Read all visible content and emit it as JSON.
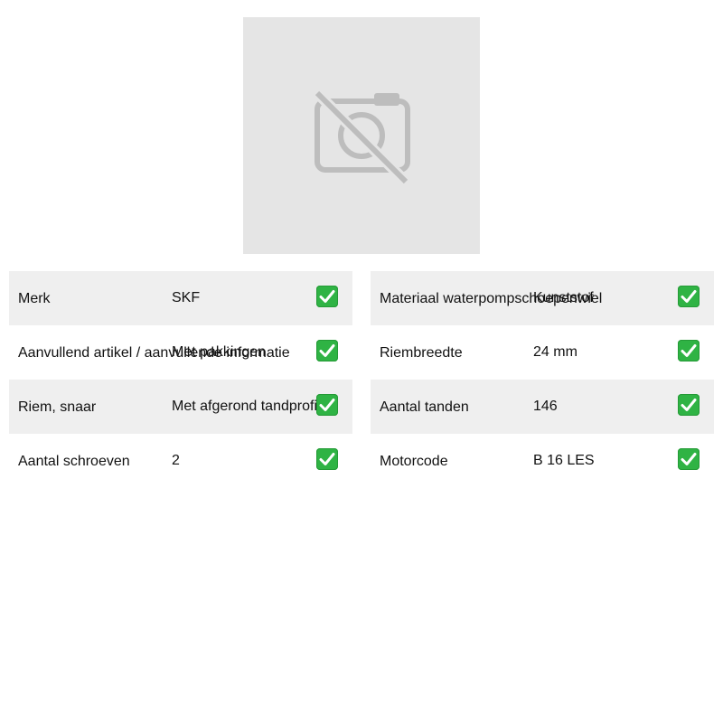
{
  "image": {
    "icon": "camera-off-icon"
  },
  "specs_left": [
    {
      "label": "Merk",
      "value": "SKF"
    },
    {
      "label": "Aanvullend artikel / aanvullende informatie",
      "value": "Met pakkingen"
    },
    {
      "label": "Riem, snaar",
      "value": "Met afgerond tandprofiel"
    },
    {
      "label": "Aantal schroeven",
      "value": "2"
    }
  ],
  "specs_right": [
    {
      "label": "Materiaal waterpompschoepenwiel",
      "value": "Kunststof"
    },
    {
      "label": "Riembreedte",
      "value": "24 mm"
    },
    {
      "label": "Aantal tanden",
      "value": "146"
    },
    {
      "label": "Motorcode",
      "value": "B 16 LES"
    }
  ],
  "check_icon": "check-mark-icon",
  "colors": {
    "row_shade": "#efefef",
    "image_placeholder": "#e5e5e5",
    "check": "#2fb344"
  }
}
